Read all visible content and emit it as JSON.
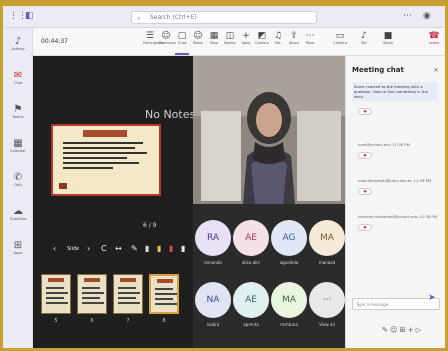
{
  "search": {
    "placeholder": "Search (Ctrl+E)"
  },
  "rail": [
    {
      "label": "Activity",
      "icon": "bell-icon"
    },
    {
      "label": "Chat",
      "icon": "chat-icon",
      "active": true
    },
    {
      "label": "Teams",
      "icon": "teams-icon"
    },
    {
      "label": "Calendar",
      "icon": "calendar-icon"
    },
    {
      "label": "Calls",
      "icon": "phone-icon"
    },
    {
      "label": "OneDrive",
      "icon": "cloud-icon"
    },
    {
      "label": "Apps",
      "icon": "apps-icon"
    }
  ],
  "meeting": {
    "title": "00:44:37"
  },
  "toolbar": [
    {
      "label": "Participants",
      "glyph": "☰"
    },
    {
      "label": "Reactions",
      "glyph": "☺"
    },
    {
      "label": "Chat",
      "glyph": "▢",
      "active": true
    },
    {
      "label": "React",
      "glyph": "☺"
    },
    {
      "label": "View",
      "glyph": "▦"
    },
    {
      "label": "Rooms",
      "glyph": "◫"
    },
    {
      "label": "Apps",
      "glyph": "+"
    },
    {
      "label": "Camera",
      "glyph": "◩"
    },
    {
      "label": "Mic",
      "glyph": "♫"
    },
    {
      "label": "Share",
      "glyph": "⇪"
    },
    {
      "label": "More",
      "glyph": "⋯"
    }
  ],
  "toolbar_right": [
    {
      "label": "Camera",
      "glyph": "▭"
    },
    {
      "label": "Mic",
      "glyph": "♪"
    },
    {
      "label": "Share",
      "glyph": "■"
    }
  ],
  "leave": {
    "label": "Leave",
    "glyph": "☎"
  },
  "stage": {
    "notes": "No Notes",
    "page": "6 / 9"
  },
  "ctrls": {
    "prev": "‹",
    "current": "Slide",
    "next": "›",
    "ex": "C"
  },
  "thumbs": [
    {
      "num": "5"
    },
    {
      "num": "6"
    },
    {
      "num": "7"
    },
    {
      "num": "8"
    }
  ],
  "participants": [
    {
      "initials": "RA",
      "name": "mmanda",
      "bg": "#e8e0f5",
      "fg": "#4b3a8a"
    },
    {
      "initials": "AE",
      "name": "alisa ahn",
      "bg": "#f5e0e8",
      "fg": "#a0365a"
    },
    {
      "initials": "AG",
      "name": "aguedela",
      "bg": "#e0e8f5",
      "fg": "#3a5a9a"
    },
    {
      "initials": "MA",
      "name": "manaad",
      "bg": "#f5ead8",
      "fg": "#7a5a20"
    },
    {
      "initials": "NA",
      "name": "nadira",
      "bg": "#e0e4f5",
      "fg": "#3a4a9a"
    },
    {
      "initials": "AE",
      "name": "aprenta",
      "bg": "#e0f0f0",
      "fg": "#2a6a6a"
    },
    {
      "initials": "MA",
      "name": "mshtuna",
      "bg": "#e8f5e0",
      "fg": "#3a6a2a"
    },
    {
      "initials": "⋯",
      "name": "View all",
      "bg": "#e8e8e8",
      "fg": "#444"
    }
  ],
  "chat": {
    "title": "Meeting chat",
    "close": "×",
    "first_message": "Some reacted to the meeting with a question. How to find something in the deck.",
    "messages": [
      {
        "meta": "noor@school.edu 11:38 PM"
      },
      {
        "meta": "noor.fahmeeda@univ.edu.bc 11:38 PM"
      },
      {
        "meta": "summer.mohamed@school.edu 11:38 PM"
      }
    ],
    "compose_placeholder": "Type a message",
    "send": "➤",
    "tools": "✎ ☺ ⊞ + ▷"
  },
  "colors": {
    "accent": "#5b5fc7",
    "frame": "#c8a030",
    "stage_bg": "#1f1f1f"
  }
}
